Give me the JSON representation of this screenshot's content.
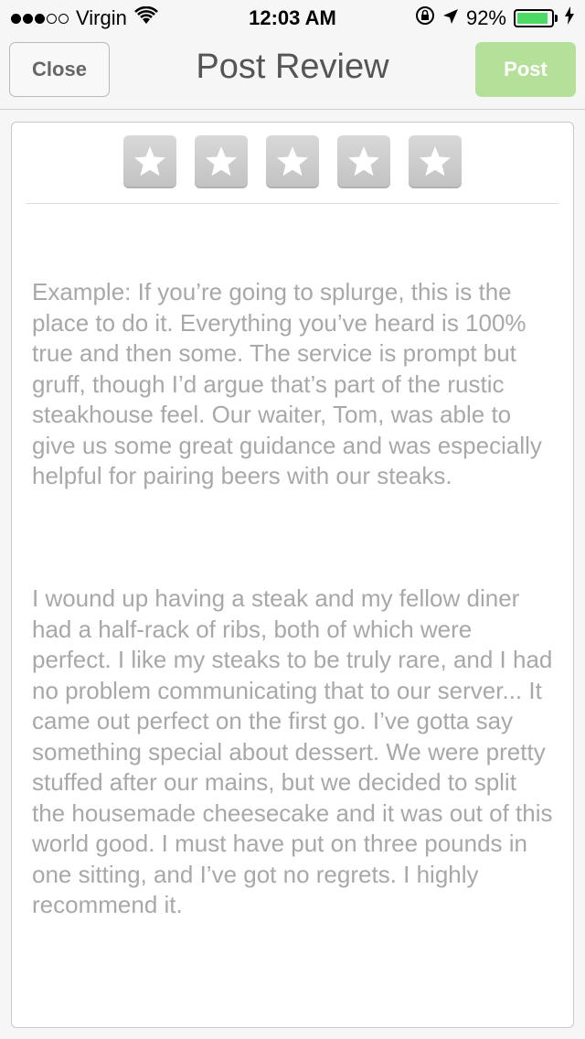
{
  "status_bar": {
    "carrier": "Virgin",
    "signal_strength": 3,
    "signal_total": 5,
    "time": "12:03 AM",
    "battery_percent": "92%",
    "battery_level": 0.92,
    "battery_color": "#4cd964"
  },
  "nav": {
    "close_label": "Close",
    "title": "Post Review",
    "post_label": "Post",
    "post_color": "#b5e09a"
  },
  "rating": {
    "selected": 0,
    "max": 5
  },
  "review": {
    "placeholder_paragraphs": [
      "Example: If you’re going to splurge, this is the place to do it. Everything you’ve heard is 100% true and then some. The service is prompt but gruff, though I’d argue that’s part of the rustic steakhouse feel. Our waiter, Tom, was able to give us some great guidance and was especially helpful for pairing beers with our steaks.",
      "I wound up having a steak and my fellow diner had a half-rack of ribs, both of which were perfect. I like my steaks to be truly rare, and I had no problem communicating that to our server... It came out perfect on the first go. I’ve gotta say something special about dessert. We were pretty stuffed after our mains, but we decided to split the housemade cheesecake and it was out of this world good. I must have put on three pounds in one sitting, and I’ve got no regrets. I highly recommend it."
    ]
  }
}
